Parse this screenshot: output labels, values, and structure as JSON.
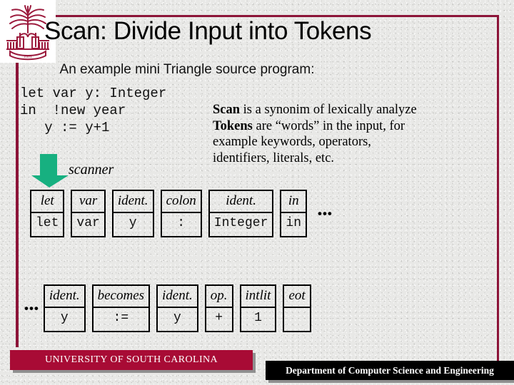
{
  "slide": {
    "title": "Scan: Divide Input into Tokens",
    "subtitle": "An example mini Triangle source program:",
    "accent_color": "#8c1438",
    "arrow_color": "#17b080"
  },
  "logo": {
    "name": "usc-palmetto-logo",
    "color": "#9c1b3d",
    "banner_text": "1801"
  },
  "code": {
    "line1": "let var y: Integer",
    "line2": "in  !new year",
    "line3": "   y := y+1"
  },
  "arrow": {
    "label": "scanner"
  },
  "explanation": {
    "line1_bold": "Scan",
    "line1_rest": " is a synonim of lexically analyze",
    "line2_bold": "Tokens",
    "line2_rest": " are “words” in the input, for",
    "line3": "example  keywords, operators,",
    "line4": "identifiers, literals, etc."
  },
  "token_rows": [
    {
      "leading_ellipsis": "",
      "trailing_ellipsis": "•••",
      "tokens": [
        {
          "kind": "let",
          "value": "let"
        },
        {
          "kind": "var",
          "value": "var"
        },
        {
          "kind": "ident.",
          "value": "y"
        },
        {
          "kind": "colon",
          "value": ":"
        },
        {
          "kind": "ident.",
          "value": "Integer"
        },
        {
          "kind": "in",
          "value": "in"
        }
      ]
    },
    {
      "leading_ellipsis": "•••",
      "trailing_ellipsis": "",
      "tokens": [
        {
          "kind": "ident.",
          "value": "y"
        },
        {
          "kind": "becomes",
          "value": ":="
        },
        {
          "kind": "ident.",
          "value": "y"
        },
        {
          "kind": "op.",
          "value": "+"
        },
        {
          "kind": "intlit",
          "value": "1"
        },
        {
          "kind": "eot",
          "value": ""
        }
      ]
    }
  ],
  "footer": {
    "university": "UNIVERSITY OF SOUTH CAROLINA",
    "university_bar_color": "#a80b35",
    "department": "Department of Computer Science and Engineering",
    "department_bar_color": "#000000"
  }
}
